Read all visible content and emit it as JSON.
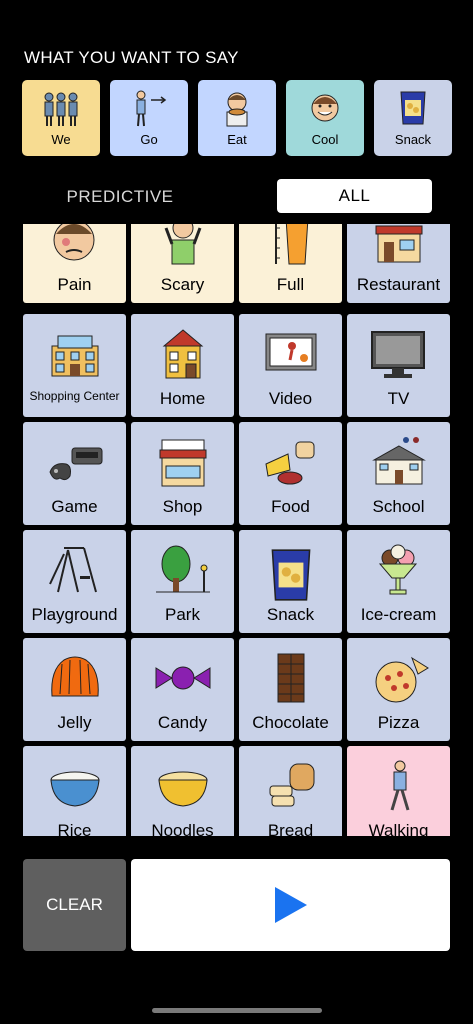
{
  "header": {
    "title": "WHAT YOU WANT TO SAY"
  },
  "sentence": [
    {
      "label": "We",
      "color": "#f7dc92",
      "icon": "people-icon"
    },
    {
      "label": "Go",
      "color": "#c2d6ff",
      "icon": "person-walking-arrow-icon"
    },
    {
      "label": "Eat",
      "color": "#c2d6ff",
      "icon": "person-eating-icon"
    },
    {
      "label": "Cool",
      "color": "#9fd9da",
      "icon": "smiling-face-icon"
    },
    {
      "label": "Snack",
      "color": "#c9d2e8",
      "icon": "snack-bag-icon"
    }
  ],
  "tabs": {
    "predictive": "PREDICTIVE",
    "all": "ALL"
  },
  "tiles": [
    {
      "label": "Pain",
      "color": "#fbf1d7",
      "icon": "pain-face-icon"
    },
    {
      "label": "Scary",
      "color": "#fbf1d7",
      "icon": "scared-person-icon"
    },
    {
      "label": "Full",
      "color": "#fbf1d7",
      "icon": "full-glass-icon"
    },
    {
      "label": "Restaurant",
      "color": "#c9d2e8",
      "icon": "restaurant-icon"
    },
    {
      "label": "Shopping Center",
      "color": "#c9d2e8",
      "icon": "mall-icon"
    },
    {
      "label": "Home",
      "color": "#c9d2e8",
      "icon": "house-icon"
    },
    {
      "label": "Video",
      "color": "#c9d2e8",
      "icon": "video-screen-icon"
    },
    {
      "label": "TV",
      "color": "#c9d2e8",
      "icon": "tv-icon"
    },
    {
      "label": "Game",
      "color": "#c9d2e8",
      "icon": "game-controller-icon"
    },
    {
      "label": "Shop",
      "color": "#c9d2e8",
      "icon": "shop-icon"
    },
    {
      "label": "Food",
      "color": "#c9d2e8",
      "icon": "food-icon"
    },
    {
      "label": "School",
      "color": "#c9d2e8",
      "icon": "school-icon"
    },
    {
      "label": "Playground",
      "color": "#c9d2e8",
      "icon": "playground-icon"
    },
    {
      "label": "Park",
      "color": "#c9d2e8",
      "icon": "tree-icon"
    },
    {
      "label": "Snack",
      "color": "#c9d2e8",
      "icon": "snack-bag-icon"
    },
    {
      "label": "Ice-cream",
      "color": "#c9d2e8",
      "icon": "ice-cream-icon"
    },
    {
      "label": "Jelly",
      "color": "#c9d2e8",
      "icon": "jelly-icon"
    },
    {
      "label": "Candy",
      "color": "#c9d2e8",
      "icon": "candy-icon"
    },
    {
      "label": "Chocolate",
      "color": "#c9d2e8",
      "icon": "chocolate-icon"
    },
    {
      "label": "Pizza",
      "color": "#c9d2e8",
      "icon": "pizza-icon"
    },
    {
      "label": "Rice",
      "color": "#c9d2e8",
      "icon": "rice-bowl-icon"
    },
    {
      "label": "Noodles",
      "color": "#c9d2e8",
      "icon": "noodles-bowl-icon"
    },
    {
      "label": "Bread",
      "color": "#c9d2e8",
      "icon": "bread-icon"
    },
    {
      "label": "Walking",
      "color": "#fbcfdc",
      "icon": "walking-person-icon"
    }
  ],
  "controls": {
    "clear_label": "CLEAR",
    "play_icon": "play-icon",
    "play_color": "#1a73f0"
  }
}
